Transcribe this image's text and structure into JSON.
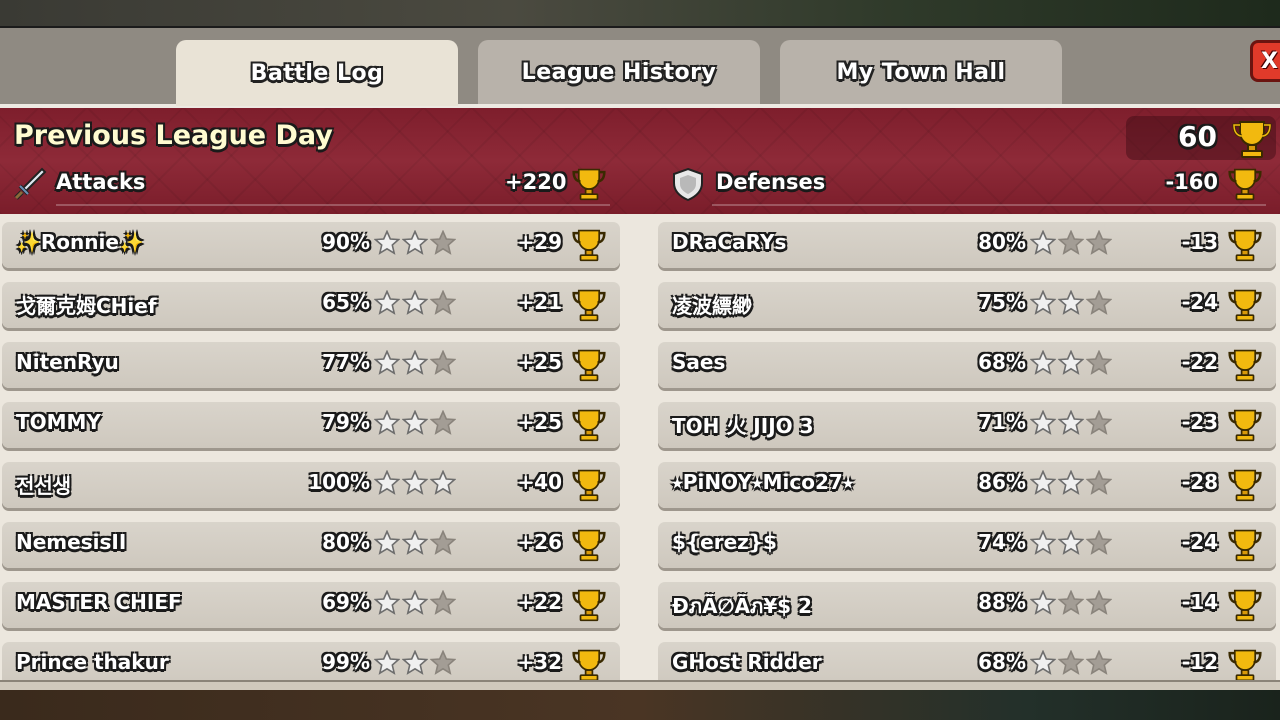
{
  "tabs": [
    {
      "label": "Battle Log",
      "active": true
    },
    {
      "label": "League History",
      "active": false
    },
    {
      "label": "My Town Hall",
      "active": false
    }
  ],
  "close_label": "X",
  "banner": {
    "title": "Previous League Day",
    "total_trophies": "60",
    "attacks_label": "Attacks",
    "attacks_total": "+220",
    "defenses_label": "Defenses",
    "defenses_total": "-160"
  },
  "attacks": [
    {
      "name": "✨Ronnie✨",
      "percent": "90%",
      "stars": 2,
      "trophies": "+29"
    },
    {
      "name": "戈爾克姆CHief",
      "percent": "65%",
      "stars": 2,
      "trophies": "+21"
    },
    {
      "name": "NitenRyu",
      "percent": "77%",
      "stars": 2,
      "trophies": "+25"
    },
    {
      "name": "TOMMY",
      "percent": "79%",
      "stars": 2,
      "trophies": "+25"
    },
    {
      "name": "전선생",
      "percent": "100%",
      "stars": 3,
      "trophies": "+40"
    },
    {
      "name": "NemesisII",
      "percent": "80%",
      "stars": 2,
      "trophies": "+26"
    },
    {
      "name": "MASTER CHIEF",
      "percent": "69%",
      "stars": 2,
      "trophies": "+22"
    },
    {
      "name": "Prince thakur",
      "percent": "99%",
      "stars": 2,
      "trophies": "+32"
    }
  ],
  "defenses": [
    {
      "name": "DRaCaRYs",
      "percent": "80%",
      "stars": 1,
      "trophies": "-13"
    },
    {
      "name": "凌波縹緲",
      "percent": "75%",
      "stars": 2,
      "trophies": "-24"
    },
    {
      "name": "Saes",
      "percent": "68%",
      "stars": 2,
      "trophies": "-22"
    },
    {
      "name": "TOH 火 JIJO 3",
      "percent": "71%",
      "stars": 2,
      "trophies": "-23"
    },
    {
      "name": "⭑PiNOY⭑Mico27⭑",
      "percent": "86%",
      "stars": 2,
      "trophies": "-28"
    },
    {
      "name": "${erez}$",
      "percent": "74%",
      "stars": 2,
      "trophies": "-24"
    },
    {
      "name": "ĐภÃ∅Ãภ¥$ 2",
      "percent": "88%",
      "stars": 1,
      "trophies": "-14"
    },
    {
      "name": "GHost Ridder",
      "percent": "68%",
      "stars": 1,
      "trophies": "-12"
    }
  ],
  "colors": {
    "banner": "#8e2a38",
    "star_on": "#f0f0f0",
    "star_off": "#a39d95",
    "trophy_gold": "#f2b90f",
    "close_button": "#e03a2a"
  },
  "icons": {
    "trophy": "trophy-icon",
    "sword": "sword-icon",
    "shield": "shield-icon",
    "star": "star-icon"
  }
}
